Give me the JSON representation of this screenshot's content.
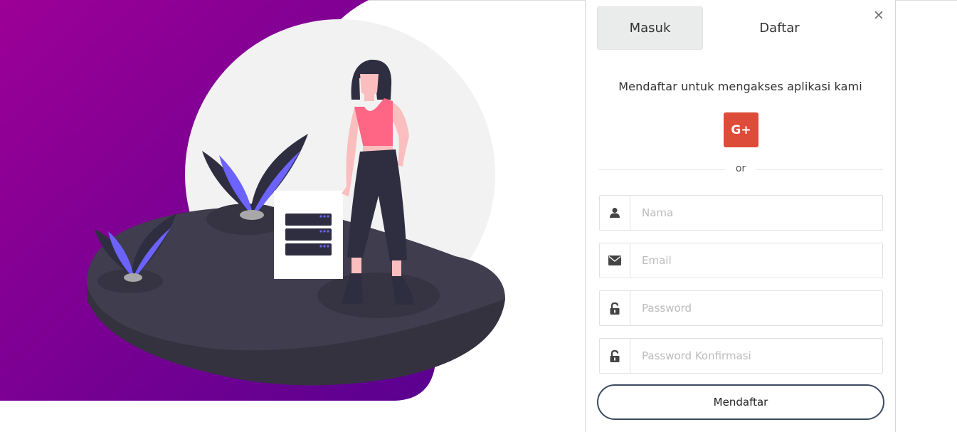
{
  "tabs": {
    "login_label": "Masuk",
    "register_label": "Daftar"
  },
  "close": {
    "icon": "close-icon",
    "glyph": "✕"
  },
  "register": {
    "subtitle": "Mendaftar untuk mengakses aplikasi kami",
    "social": {
      "icon": "google-plus-icon",
      "label": "G+",
      "color": "#dd4b39"
    },
    "divider_text": "or",
    "fields": {
      "name": {
        "placeholder": "Nama",
        "icon": "user-icon"
      },
      "email": {
        "placeholder": "Email",
        "icon": "envelope-icon"
      },
      "password": {
        "placeholder": "Password",
        "icon": "unlock-icon"
      },
      "password_confirm": {
        "placeholder": "Password Konfirmasi",
        "icon": "unlock-icon"
      }
    },
    "submit_label": "Mendaftar"
  },
  "colors": {
    "hero_gradient_start": "#9b0097",
    "hero_gradient_end": "#5e0092",
    "button_border": "#3b4a63",
    "island": "#3f3d4e"
  }
}
